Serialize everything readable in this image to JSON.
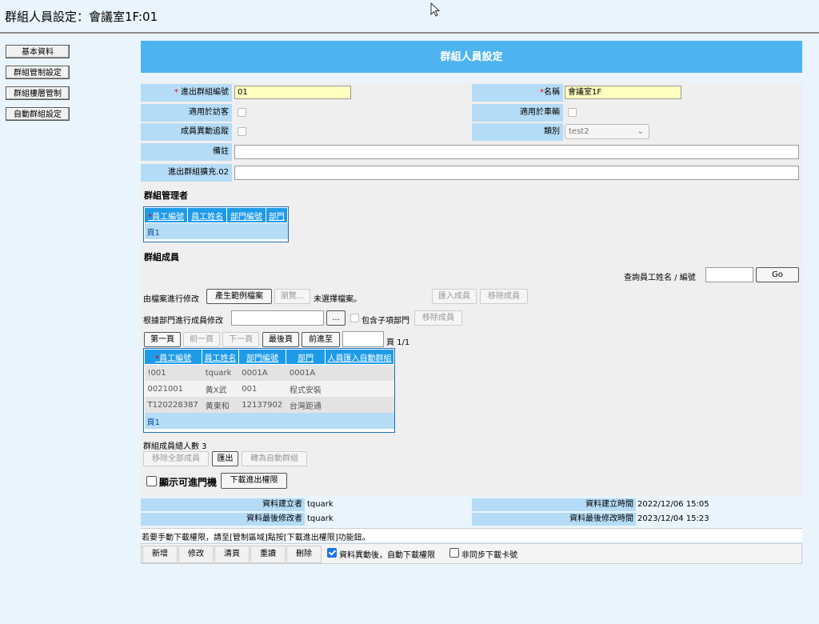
{
  "page_title": "群組人員設定：會議室1F:01",
  "sidebar": {
    "items": [
      {
        "label": "基本資料"
      },
      {
        "label": "群組管制設定"
      },
      {
        "label": "群組樓層管制"
      },
      {
        "label": "自動群組設定"
      }
    ]
  },
  "header": {
    "title": "群組人員設定"
  },
  "form": {
    "group_code_label": "進出群組編號",
    "group_code_value": "01",
    "name_label": "名稱",
    "name_value": "會議室1F",
    "visitor_label": "適用於訪客",
    "vehicle_label": "適用於車輛",
    "member_track_label": "成員異動追蹤",
    "category_label": "類別",
    "category_value": "test2",
    "remark_label": "備註",
    "ext_label": "進出群組擴充.02",
    "required_mark": "*"
  },
  "managers": {
    "title": "群組管理者",
    "columns": [
      "員工編號",
      "員工姓名",
      "部門編號",
      "部門"
    ],
    "page_label": "頁1"
  },
  "members": {
    "title": "群組成員",
    "query_label": "查詢員工姓名 / 編號",
    "go_label": "Go",
    "file_modify_label": "由檔案進行修改",
    "gen_sample_label": "產生範例檔案",
    "browse_label": "瀏覽...",
    "no_file_label": "未選擇檔案。",
    "import_label": "匯入成員",
    "remove_label": "移除成員",
    "dept_modify_label": "根據部門進行成員修改",
    "dots_label": "...",
    "include_sub_label": "包含子項部門",
    "remove_label2": "移除成員",
    "pager": {
      "first": "第一頁",
      "prev": "前一頁",
      "next": "下一頁",
      "last": "最後頁",
      "goto": "前進至",
      "page_info": "頁 1/1"
    },
    "columns": [
      "員工編號",
      "員工姓名",
      "部門編號",
      "部門",
      "人員匯入自動群組"
    ],
    "rows": [
      [
        "!001",
        "tquark",
        "0001A",
        "0001A",
        ""
      ],
      [
        "0021001",
        "黃X武",
        "001",
        "程式安裝",
        ""
      ],
      [
        "T120228387",
        "黃東和",
        "12137902",
        "台灣距通",
        ""
      ]
    ],
    "page_label": "頁1",
    "total_label": "群組成員總人數 3",
    "remove_all_label": "移除全部成員",
    "export_label": "匯出",
    "to_auto_label": "轉為自動群組",
    "show_door_label": "顯示可進門機",
    "download_label": "下載進出權限"
  },
  "audit": {
    "creator_label": "資料建立者",
    "creator_value": "tquark",
    "created_time_label": "資料建立時間",
    "created_time_value": "2022/12/06 15:05",
    "modifier_label": "資料最後修改者",
    "modifier_value": "tquark",
    "modified_time_label": "資料最後修改時間",
    "modified_time_value": "2023/12/04 15:23"
  },
  "note": "若要手動下載權限，請至[管制區域]點按[下載進出權限]功能鈕。",
  "toolbar": {
    "add": "新增",
    "edit": "修改",
    "clear": "清頁",
    "reread": "重讀",
    "delete": "刪除",
    "auto_download_label": "資料異動後，自動下載權限",
    "async_label": "非同步下載卡號"
  }
}
